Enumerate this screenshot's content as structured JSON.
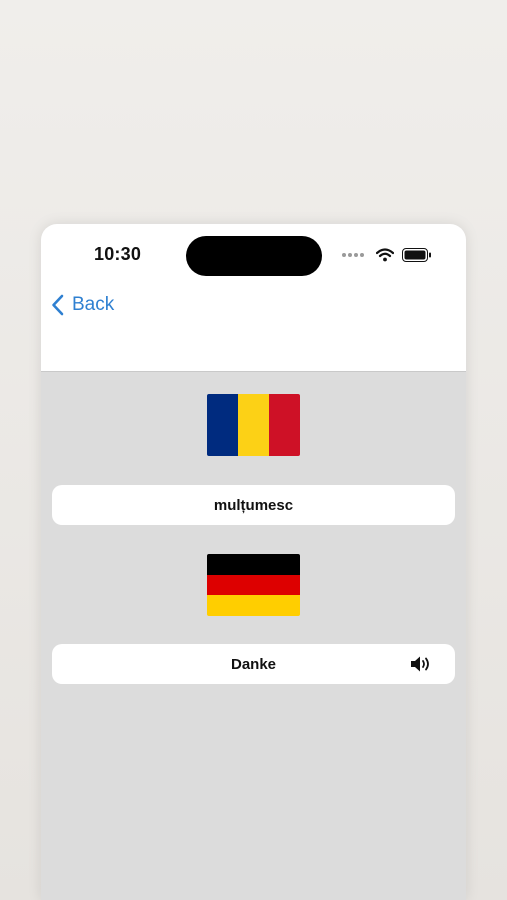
{
  "status_bar": {
    "time": "10:30",
    "icons": [
      "signal-dots-icon",
      "wifi-icon",
      "battery-icon"
    ]
  },
  "nav": {
    "back_label": "Back",
    "back_icon": "chevron-left-icon"
  },
  "source": {
    "flag": "romania-flag",
    "flag_colors": [
      "#002b7f",
      "#fcd116",
      "#ce1126"
    ],
    "word": "mulțumesc"
  },
  "target": {
    "flag": "germany-flag",
    "flag_colors": [
      "#000000",
      "#dd0000",
      "#ffce00"
    ],
    "word": "Danke",
    "audio_icon": "speaker-icon"
  },
  "colors": {
    "accent": "#2f80d1",
    "content_background": "#dcdcdc",
    "card_background": "#ffffff"
  }
}
